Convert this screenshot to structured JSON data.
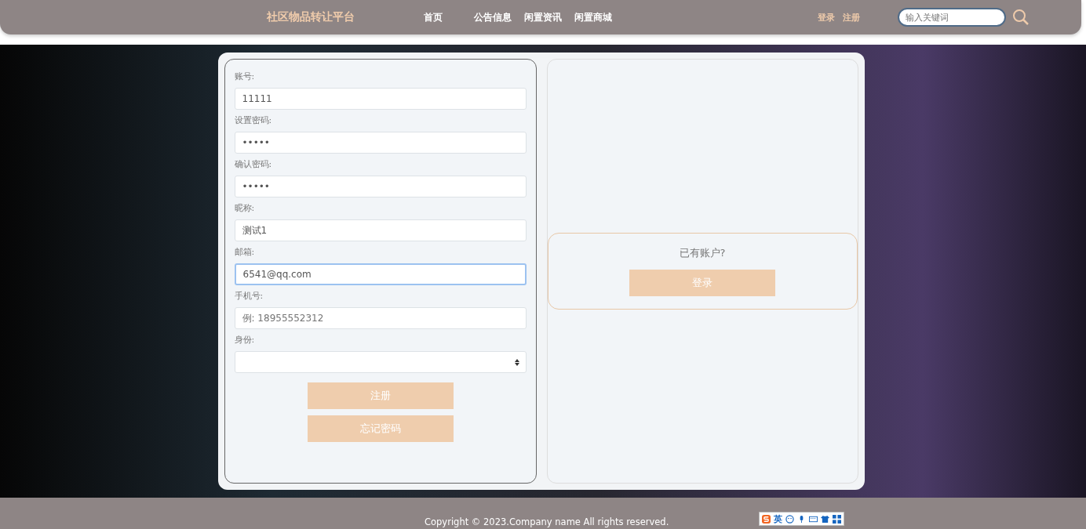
{
  "header": {
    "site_title": "社区物品转让平台",
    "nav": [
      {
        "label": "首页"
      },
      {
        "label": "公告信息"
      },
      {
        "label": "闲置资讯"
      },
      {
        "label": "闲置商城"
      }
    ],
    "auth_links": [
      {
        "label": "登录"
      },
      {
        "label": "注册"
      }
    ],
    "search": {
      "placeholder": "输入关键词"
    }
  },
  "register_form": {
    "fields": [
      {
        "label": "账号:",
        "kind": "text",
        "value": "11111",
        "focused": false
      },
      {
        "label": "设置密码:",
        "kind": "text",
        "value": "•••••",
        "focused": false
      },
      {
        "label": "确认密码:",
        "kind": "text",
        "value": "•••••",
        "focused": false
      },
      {
        "label": "昵称:",
        "kind": "text",
        "value": "测试1",
        "focused": false
      },
      {
        "label": "邮箱:",
        "kind": "text",
        "value": "6541@qq.com",
        "focused": true
      },
      {
        "label": "手机号:",
        "kind": "text",
        "placeholder": "例: 18955552312",
        "focused": false
      },
      {
        "label": "身份:",
        "kind": "select",
        "focused": false
      }
    ],
    "buttons": [
      "注册",
      "忘记密码"
    ]
  },
  "login_panel": {
    "prompt": "已有账户?",
    "button": "登录"
  },
  "footer": {
    "copyright": "Copyright © 2023.Company name All rights reserved.",
    "ime_toolbar": {
      "mode": "英"
    }
  }
}
